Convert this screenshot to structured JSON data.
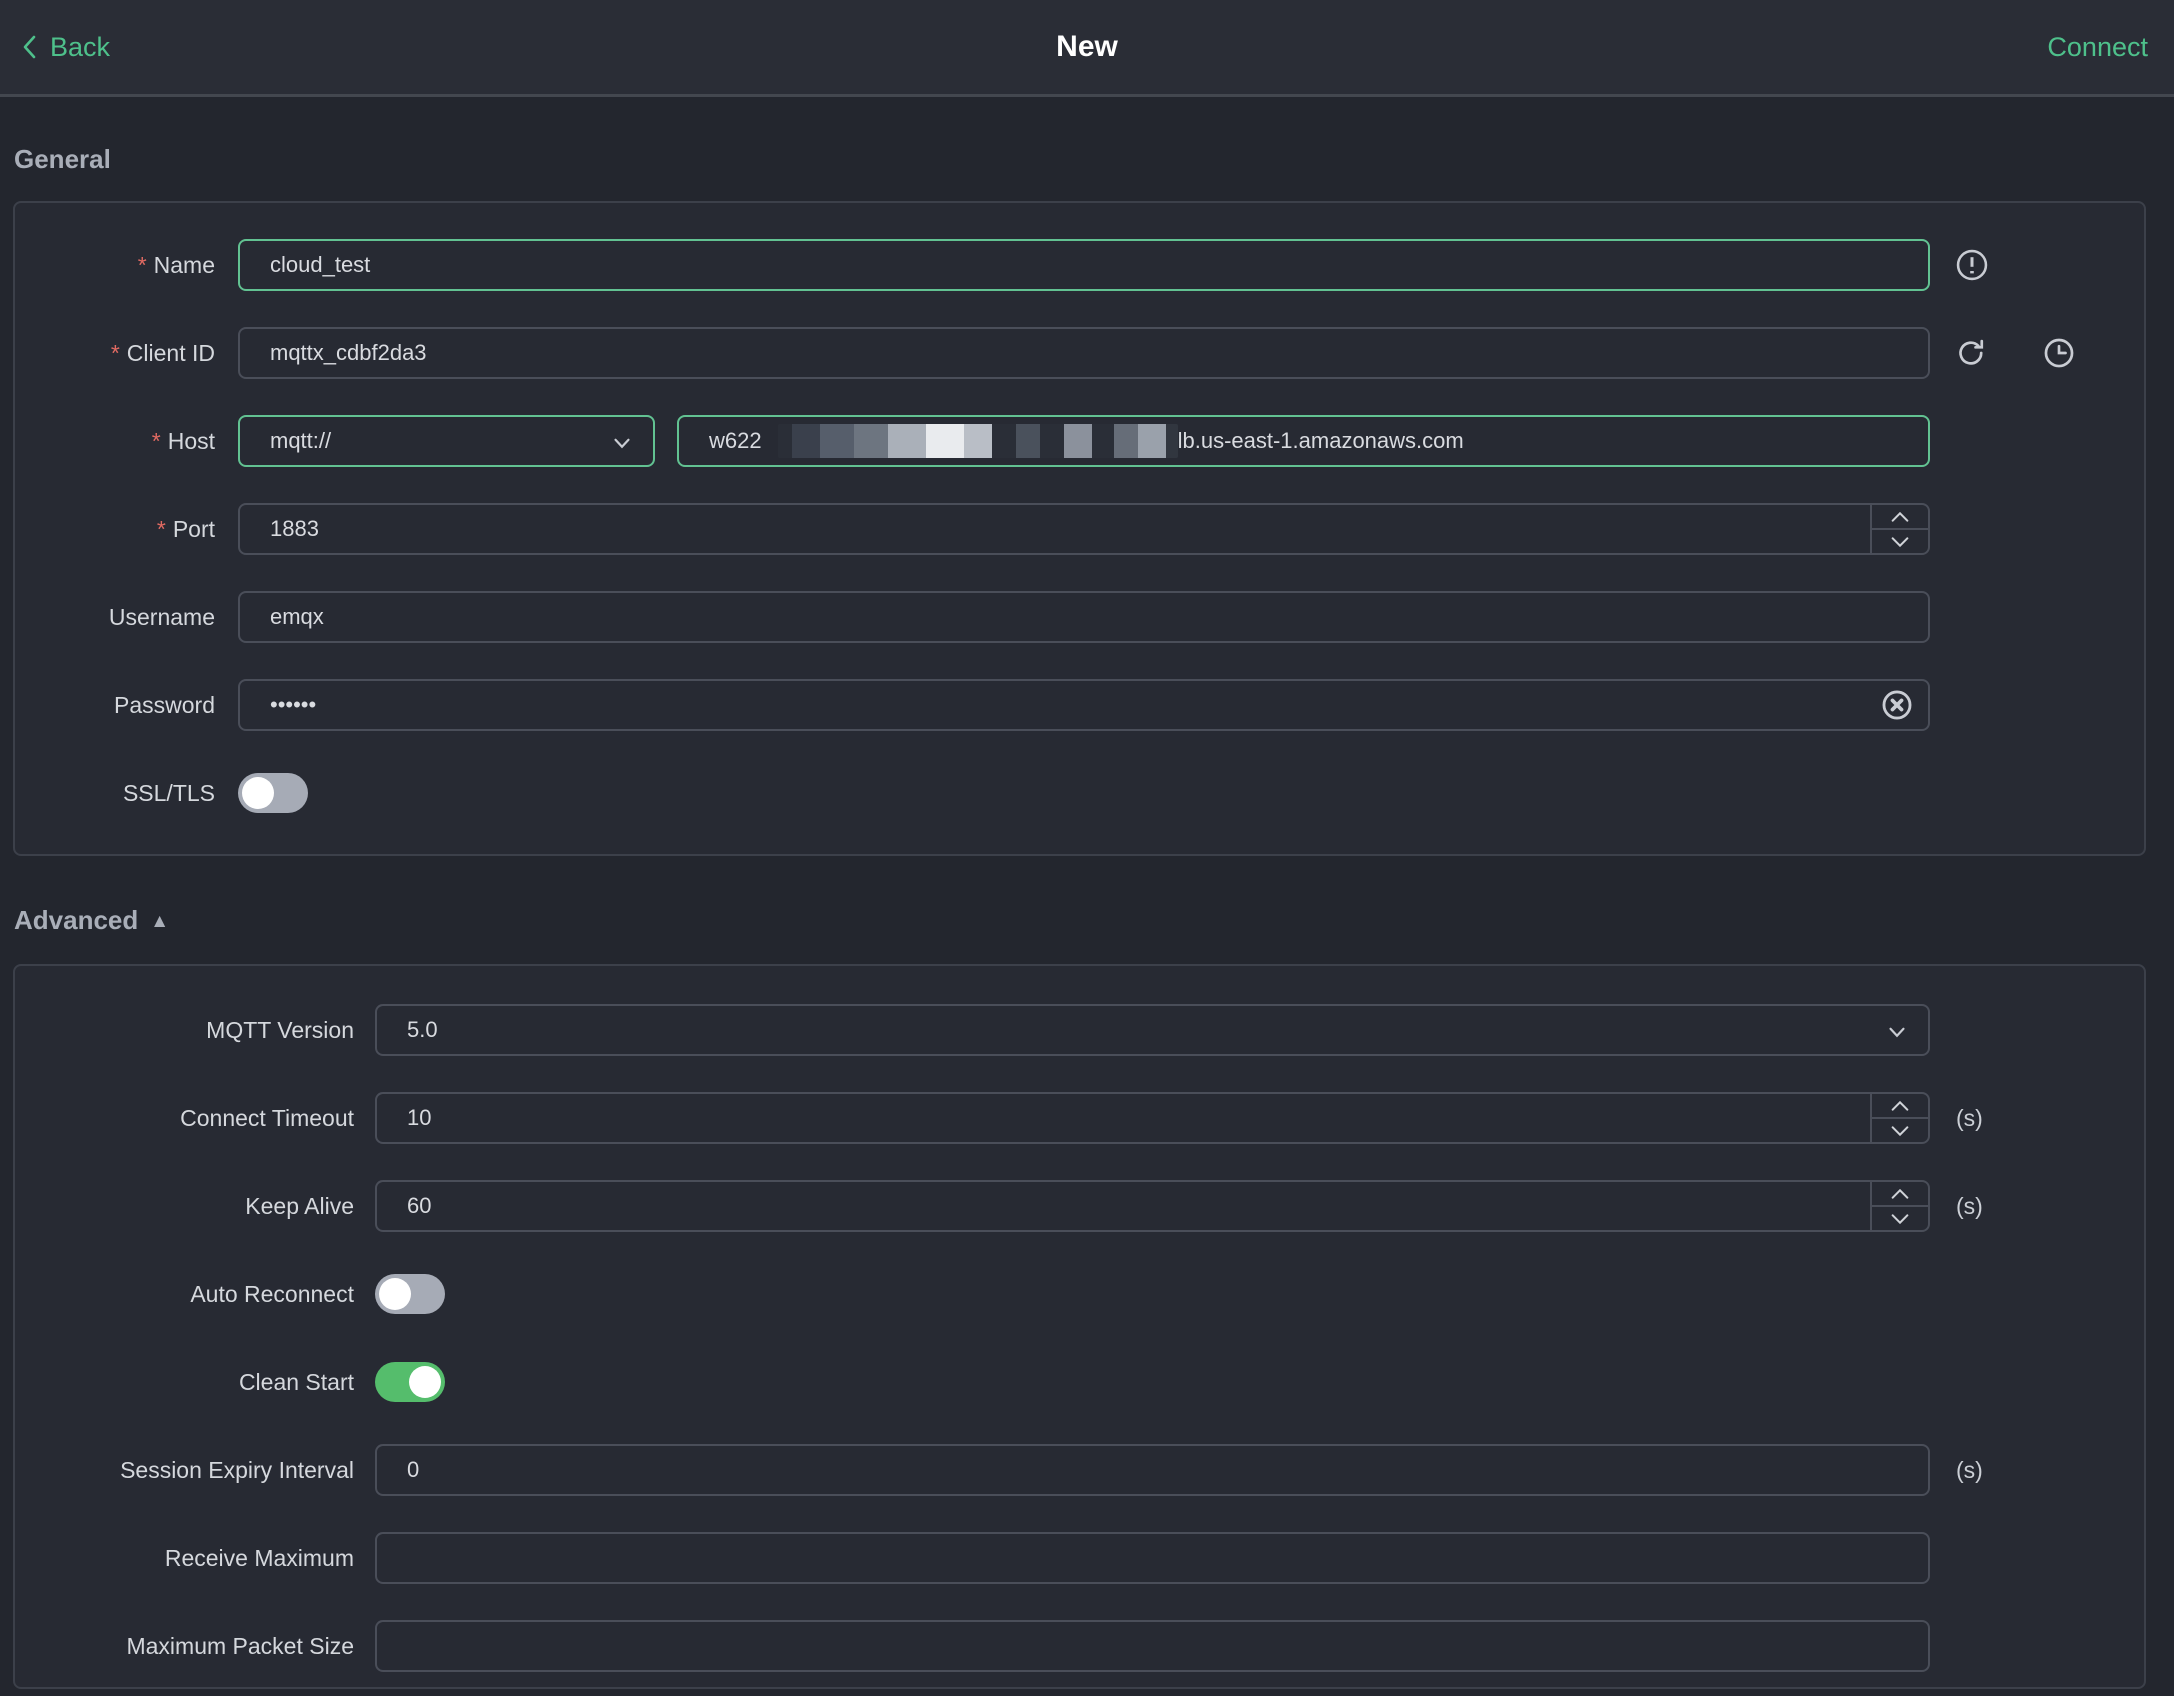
{
  "header": {
    "back_label": "Back",
    "title": "New",
    "connect_label": "Connect"
  },
  "misc": {
    "required_marker": "*"
  },
  "icons": {
    "back": "chevron-left",
    "name_status": "exclamation-circle",
    "client_id_refresh": "refresh",
    "client_id_history": "clock",
    "protocol_dropdown": "chevron-down",
    "password_clear": "circle-x",
    "number_spinner_up": "chevron-up",
    "number_spinner_down": "chevron-down",
    "mqtt_version_dropdown": "chevron-down",
    "advanced_collapse_glyph": "▲"
  },
  "general": {
    "section_title": "General",
    "name": {
      "label": "Name",
      "required": true,
      "value": "cloud_test"
    },
    "client_id": {
      "label": "Client ID",
      "required": true,
      "value": "mqttx_cdbf2da3"
    },
    "host": {
      "label": "Host",
      "required": true,
      "protocol": "mqtt://",
      "value_prefix": "w622",
      "value_suffix": "lb.us-east-1.amazonaws.com",
      "middle_redacted": true
    },
    "port": {
      "label": "Port",
      "required": true,
      "value": "1883"
    },
    "username": {
      "label": "Username",
      "value": "emqx"
    },
    "password": {
      "label": "Password",
      "value": "••••••"
    },
    "ssl": {
      "label": "SSL/TLS",
      "enabled": false
    }
  },
  "advanced": {
    "section_title": "Advanced",
    "mqtt_version": {
      "label": "MQTT Version",
      "value": "5.0"
    },
    "connect_timeout": {
      "label": "Connect Timeout",
      "value": "10",
      "unit": "(s)"
    },
    "keep_alive": {
      "label": "Keep Alive",
      "value": "60",
      "unit": "(s)"
    },
    "auto_reconnect": {
      "label": "Auto Reconnect",
      "enabled": false
    },
    "clean_start": {
      "label": "Clean Start",
      "enabled": true
    },
    "session_expiry": {
      "label": "Session Expiry Interval",
      "value": "0",
      "unit": "(s)"
    },
    "receive_maximum": {
      "label": "Receive Maximum",
      "value": ""
    },
    "maximum_packet_size": {
      "label": "Maximum Packet Size",
      "value": ""
    }
  },
  "colors": {
    "accent_green": "#4ec08b",
    "border_green": "#62c292",
    "toggle_on_green": "#55bd6c",
    "toggle_off_gray": "#a6abb6",
    "error_red": "#e16a62",
    "panel_bg": "#272a33",
    "content_bg": "#23262e",
    "topbar_bg": "#2a2d36"
  }
}
